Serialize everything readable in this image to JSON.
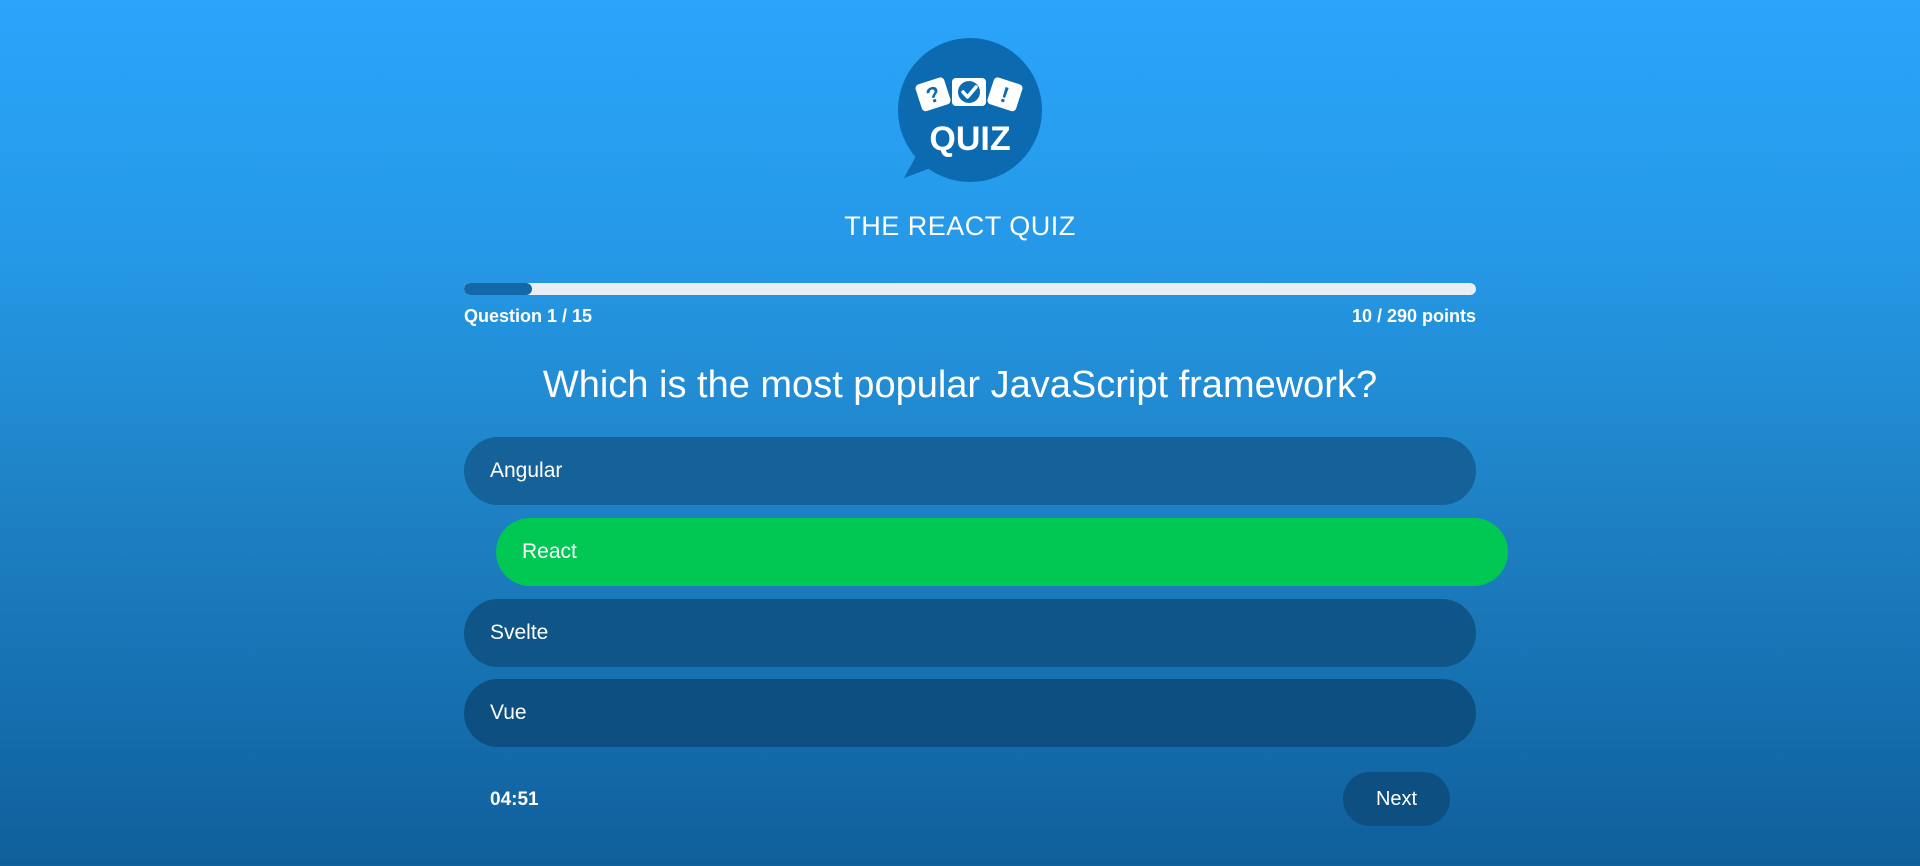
{
  "app": {
    "title": "THE REACT QUIZ",
    "logo_text": "QUIZ"
  },
  "progress": {
    "current": 1,
    "total": 15,
    "fill_fraction": 0.067,
    "question_label": "Question 1 / 15",
    "points_label": "10 / 290 points"
  },
  "question": {
    "text": "Which is the most popular JavaScript framework?"
  },
  "options": [
    {
      "label": "Angular",
      "state": "default"
    },
    {
      "label": "React",
      "state": "selected-correct"
    },
    {
      "label": "Svelte",
      "state": "default"
    },
    {
      "label": "Vue",
      "state": "default"
    }
  ],
  "footer": {
    "timer": "04:51",
    "next_label": "Next"
  },
  "colors": {
    "background_top": "#2aa5fb",
    "background_bottom": "#0f5f9a",
    "option_default": "#15619a",
    "option_correct": "#00c853",
    "progress_fill": "#1467a8",
    "progress_track": "#e8eef3",
    "logo_bubble": "#0c6bb0"
  }
}
